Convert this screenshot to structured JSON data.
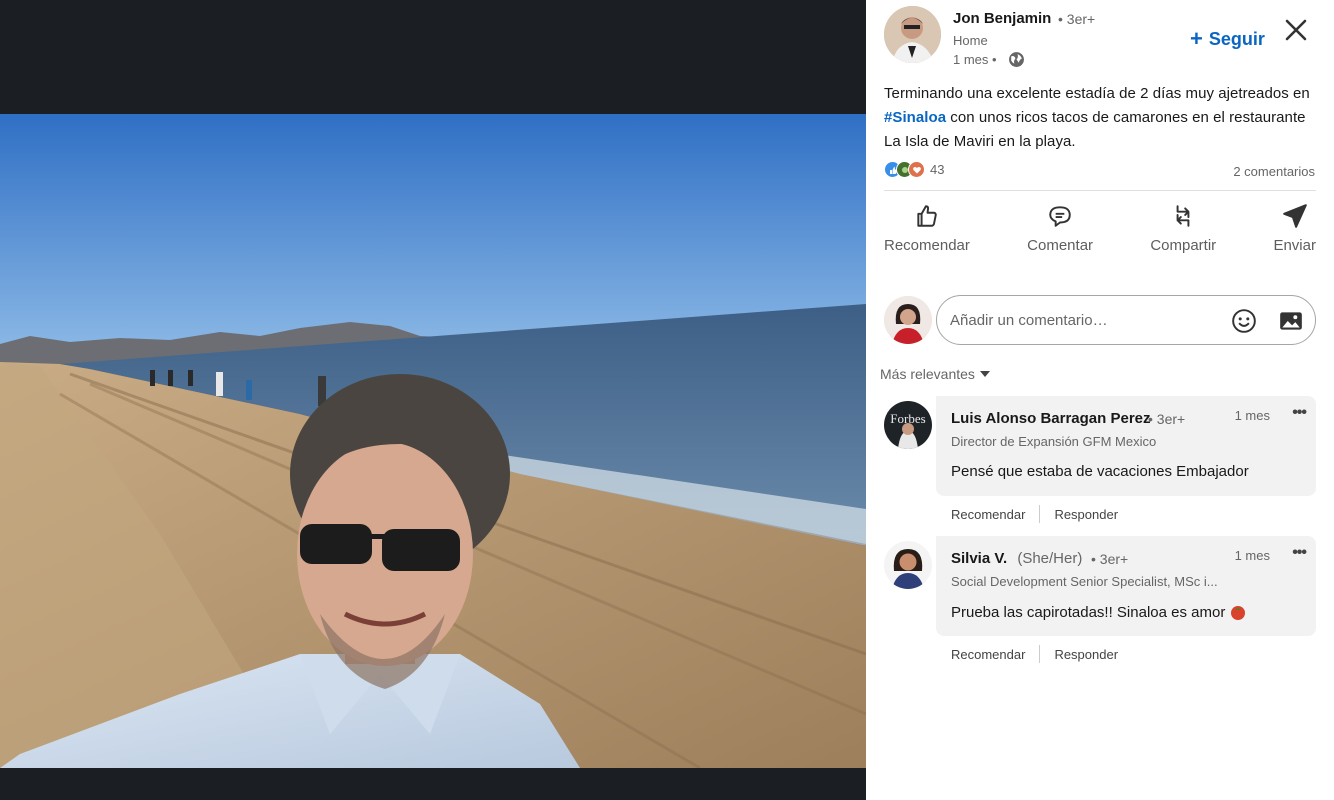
{
  "post": {
    "author": {
      "name": "Jon Benjamin",
      "degree": "• 3er+",
      "headline": "Home",
      "time": "1 mes •"
    },
    "follow_label": "Seguir",
    "text_part1": "Terminando una excelente estadía de 2 días muy ajetreados en ",
    "hashtag": "#Sinaloa",
    "text_part2": " con unos ricos tacos de camarones en el restaurante La Isla de Maviri en la playa.",
    "reactions_count": "43",
    "comments_count": "2 comentarios"
  },
  "actions": {
    "like": "Recomendar",
    "comment": "Comentar",
    "share": "Compartir",
    "send": "Enviar"
  },
  "composer": {
    "placeholder": "Añadir un comentario…"
  },
  "sort_label": "Más relevantes",
  "comments": [
    {
      "name": "Luis Alonso Barragan Perez",
      "pronoun": "",
      "degree": "• 3er+",
      "headline": "Director de Expansión GFM Mexico",
      "time": "1 mes",
      "text": "Pensé que estaba de vacaciones Embajador",
      "like": "Recomendar",
      "reply": "Responder",
      "avatar_text": "Forbes"
    },
    {
      "name": "Silvia V.",
      "pronoun": "(She/Her)",
      "degree": "• 3er+",
      "headline": "Social Development Senior Specialist, MSc i...",
      "time": "1 mes",
      "text": "Prueba las capirotadas!! Sinaloa es amor",
      "like": "Recomendar",
      "reply": "Responder"
    }
  ],
  "colors": {
    "brand": "#0a66c2",
    "dark_bg": "#1b1f23",
    "comment_bg": "#f2f2f2"
  },
  "icons": {
    "follow": "plus-icon",
    "close": "close-icon",
    "visibility": "globe-icon",
    "emoji": "emoji-icon",
    "image": "image-icon"
  }
}
